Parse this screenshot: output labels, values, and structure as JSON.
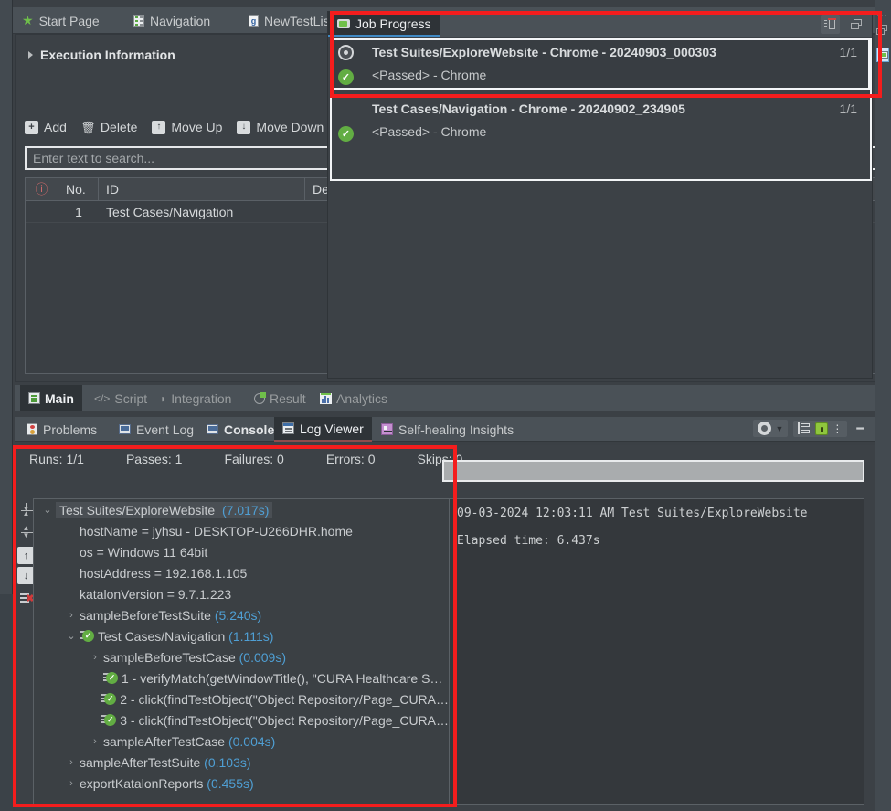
{
  "editor_tabs": [
    {
      "label": "Start Page",
      "icon": "star-icon",
      "selected": false
    },
    {
      "label": "Navigation",
      "icon": "test-case-icon",
      "selected": false
    },
    {
      "label": "NewTestLis",
      "icon": "groovy-script-icon",
      "selected": false
    }
  ],
  "execution_information": {
    "section_title": "Execution Information",
    "actions": [
      {
        "label": "Add",
        "icon": "plus-icon"
      },
      {
        "label": "Delete",
        "icon": "trash-icon"
      },
      {
        "label": "Move Up",
        "icon": "arrow-up-icon"
      },
      {
        "label": "Move Down",
        "icon": "arrow-down-icon"
      }
    ],
    "search_placeholder": "Enter text to search...",
    "table": {
      "columns": [
        "",
        "No.",
        "ID",
        "De"
      ],
      "rows": [
        {
          "no": "1",
          "id": "Test Cases/Navigation",
          "description": ""
        }
      ]
    }
  },
  "job_progress": {
    "tab_label": "Job Progress",
    "tab_icon": "job-progress-icon",
    "tools": [
      {
        "name": "clear-all-icon",
        "glyph": "🗑"
      },
      {
        "name": "restore-view-icon",
        "glyph": "❐"
      }
    ],
    "jobs": [
      {
        "title": "Test Suites/ExploreWebsite - Chrome - 20240903_000303",
        "count": "1/1",
        "status_line": "<Passed> - Chrome",
        "selected": true,
        "status_icon": "passed-icon",
        "job_icon": "running-icon"
      },
      {
        "title": "Test Cases/Navigation - Chrome - 20240902_234905",
        "count": "1/1",
        "status_line": "<Passed> - Chrome",
        "selected": false,
        "status_icon": "passed-icon",
        "job_icon": "running-icon"
      }
    ]
  },
  "main_tabs": [
    {
      "label": "Main",
      "icon": "main-icon",
      "selected": true
    },
    {
      "label": "Script",
      "icon": "code-icon",
      "selected": false
    },
    {
      "label": "Integration",
      "icon": "integration-icon",
      "selected": false
    },
    {
      "label": "Result",
      "icon": "result-icon",
      "selected": false
    },
    {
      "label": "Analytics",
      "icon": "analytics-icon",
      "selected": false
    }
  ],
  "bottom_tabs": [
    {
      "label": "Problems",
      "icon": "problems-icon",
      "selected": false,
      "bold": false
    },
    {
      "label": "Event Log",
      "icon": "event-log-icon",
      "selected": false,
      "bold": false
    },
    {
      "label": "Console",
      "icon": "console-icon",
      "selected": false,
      "bold": true
    },
    {
      "label": "Log Viewer",
      "icon": "log-viewer-icon",
      "selected": true,
      "bold": false
    },
    {
      "label": "Self-healing Insights",
      "icon": "self-healing-icon",
      "selected": false,
      "bold": false
    }
  ],
  "bottom_tools": [
    {
      "name": "view-eye-icon",
      "glyph": "◉"
    },
    {
      "name": "chevron-down-icon",
      "glyph": "▼"
    },
    {
      "name": "tree-layout-icon",
      "glyph": "☰"
    },
    {
      "name": "lock-icon",
      "glyph": "🔒"
    },
    {
      "name": "view-menu-icon",
      "glyph": "⋮"
    },
    {
      "name": "minimize-icon",
      "glyph": "−"
    },
    {
      "name": "maximize-icon",
      "glyph": "❐"
    }
  ],
  "log_viewer": {
    "summary": [
      {
        "label": "Runs:",
        "value": "1/1"
      },
      {
        "label": "Passes:",
        "value": "1"
      },
      {
        "label": "Failures:",
        "value": "0"
      },
      {
        "label": "Errors:",
        "value": "0"
      },
      {
        "label": "Skips:",
        "value": "0"
      }
    ],
    "progress_percent": 100,
    "rail_buttons": [
      {
        "name": "collapse-all-icon",
        "glyph": "↧"
      },
      {
        "name": "expand-all-icon",
        "glyph": "↥"
      },
      {
        "name": "previous-node-icon",
        "glyph": "↑"
      },
      {
        "name": "next-node-icon",
        "glyph": "↓"
      },
      {
        "name": "clear-log-icon",
        "glyph": "✕"
      }
    ],
    "tree": [
      {
        "indent": 0,
        "arrow": "⌄",
        "icon": "none",
        "label": "Test Suites/ExploreWebsite",
        "duration": "(7.017s)",
        "selected": true
      },
      {
        "indent": 1,
        "arrow": "",
        "icon": "none",
        "label": "hostName = jyhsu - DESKTOP-U266DHR.home",
        "duration": "",
        "selected": false
      },
      {
        "indent": 1,
        "arrow": "",
        "icon": "none",
        "label": "os = Windows 11 64bit",
        "duration": "",
        "selected": false
      },
      {
        "indent": 1,
        "arrow": "",
        "icon": "none",
        "label": "hostAddress = 192.168.1.105",
        "duration": "",
        "selected": false
      },
      {
        "indent": 1,
        "arrow": "",
        "icon": "none",
        "label": "katalonVersion = 9.7.1.223",
        "duration": "",
        "selected": false
      },
      {
        "indent": 1,
        "arrow": "›",
        "icon": "none",
        "label": "sampleBeforeTestSuite",
        "duration": "(5.240s)",
        "selected": false
      },
      {
        "indent": 1,
        "arrow": "⌄",
        "icon": "step-passed",
        "label": "Test Cases/Navigation",
        "duration": "(1.111s)",
        "selected": false
      },
      {
        "indent": 2,
        "arrow": "›",
        "icon": "none",
        "label": "sampleBeforeTestCase",
        "duration": "(0.009s)",
        "selected": false
      },
      {
        "indent": 2,
        "arrow": "",
        "icon": "step-passed",
        "label": "1 - verifyMatch(getWindowTitle(), \"CURA Healthcare S…",
        "duration": "",
        "selected": false
      },
      {
        "indent": 2,
        "arrow": "",
        "icon": "step-passed",
        "label": "2 - click(findTestObject(\"Object Repository/Page_CURA…",
        "duration": "",
        "selected": false
      },
      {
        "indent": 2,
        "arrow": "",
        "icon": "step-passed",
        "label": "3 - click(findTestObject(\"Object Repository/Page_CURA…",
        "duration": "",
        "selected": false
      },
      {
        "indent": 2,
        "arrow": "›",
        "icon": "none",
        "label": "sampleAfterTestCase",
        "duration": "(0.004s)",
        "selected": false
      },
      {
        "indent": 1,
        "arrow": "›",
        "icon": "none",
        "label": "sampleAfterTestSuite",
        "duration": "(0.103s)",
        "selected": false
      },
      {
        "indent": 1,
        "arrow": "›",
        "icon": "none",
        "label": "exportKatalonReports",
        "duration": "(0.455s)",
        "selected": false
      }
    ],
    "console_output": "09-03-2024 12:03:11 AM Test Suites/ExploreWebsite\n\nElapsed time: 6.437s"
  },
  "colors": {
    "accent_blue": "#3f89c4",
    "pass_green": "#62ad43",
    "annotation_red": "#f41d1d",
    "duration_blue": "#4f9fd4",
    "panel_bg": "#3c4146",
    "tabbar_bg": "#4a5157"
  }
}
